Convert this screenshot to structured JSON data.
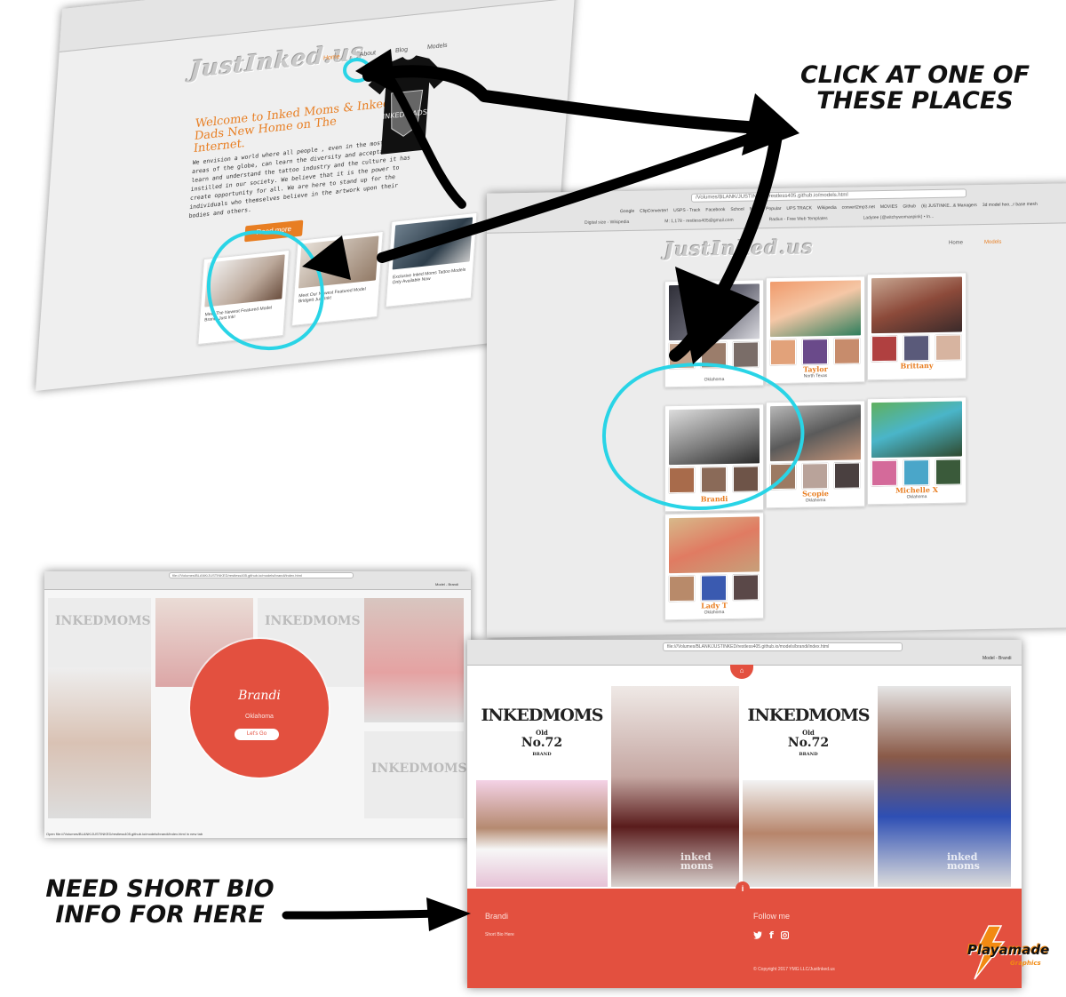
{
  "annotations": {
    "click_line1": "CLICK AT ONE OF",
    "click_line2": "THESE PLACES",
    "bio_line1": "NEED SHORT BIO",
    "bio_line2": "INFO FOR HERE"
  },
  "home_page": {
    "logo": "JustInked.us",
    "nav": [
      "Home",
      "About",
      "Blog",
      "Models"
    ],
    "welcome_title": "Welcome to Inked Moms & Inked Dads New Home on The Internet.",
    "intro": "We envision a world where all people , even in the most remote areas of the globe, can learn the diversity and acceptance to learn and understand the tattoo industry and the culture it has instilled in our society. We believe that it is the power to create opportunity for all. We are here to stand up for the individuals who themselves believe in the artwork upon their bodies and others.",
    "read_more": "Read more",
    "posts": [
      "Meet The Newest Featured Model Brandi Just Ink!",
      "Meet Our Newest Featured Model Bridgett Just Ink!",
      "Exclusive Inked Moms Tattoo Models Only Available Now"
    ],
    "tshirt_text": "INKED DADS"
  },
  "models_page": {
    "url": "/Volumes/BLANK/JUSTINKED/restless405.github.io/models.html",
    "logo": "JustInked.us",
    "nav": [
      "Home",
      "Models"
    ],
    "bookmarks": [
      "Google",
      "ClipConverter!",
      "USPS - Track",
      "Facebook",
      "School",
      "News",
      "Popular",
      "UPS TRACK",
      "Wikipedia",
      "convert2mp3.net",
      "MOVIES",
      "Github",
      "(6) JUSTINKE...& Managers",
      "3d model hoo...r base mesh"
    ],
    "tabs": [
      "Digital size - Wikipedia",
      "M: 1,178 - restless405@gmail.com",
      "Radius - Free Web Templates",
      "Ladytee (@witchywomanpink) • In..."
    ],
    "models": [
      {
        "name": "",
        "location": "Oklahoma"
      },
      {
        "name": "Taylor",
        "location": "North Texas"
      },
      {
        "name": "Brittany",
        "location": ""
      },
      {
        "name": "Brandi",
        "location": ""
      },
      {
        "name": "Scopie",
        "location": "Oklahoma"
      },
      {
        "name": "Michelle X",
        "location": "Oklahoma"
      },
      {
        "name": "Lady T",
        "location": "Oklahoma"
      }
    ]
  },
  "brandi_splash": {
    "url": "file:///Volumes/BLANK/JUSTINKED/restless405.github.io/models/brandi/index.html",
    "name": "Brandi",
    "location": "Oklahoma",
    "button": "Let's Go",
    "status": "Open file:///Volumes/BLANK/JUSTINKED/restless405.github.io/models/brandi/index.html in new tab",
    "tab_active": "Model - Brandi"
  },
  "brandi_page": {
    "url": "file:///Volumes/BLANK/JUSTINKED/restless405.github.io/models/brandi/index.html",
    "brand": "INKEDMOMS",
    "brand_sub1": "Old",
    "brand_sub2": "No.72",
    "brand_sub3": "BRAND",
    "watermark": "inked moms",
    "footer_name": "Brandi",
    "footer_bio": "Short Bio Here",
    "follow": "Follow me",
    "copyright": "© Copyright 2017 YMG LLC/JustInked.us",
    "tab_active": "Model - Brandi"
  },
  "badge": {
    "main": "Playamade",
    "sub": "Graphics"
  },
  "colors": {
    "accent_orange": "#e87e22",
    "footer_red": "#e3503f",
    "circle_cyan": "#29d4e6",
    "arrow_black": "#000000"
  }
}
